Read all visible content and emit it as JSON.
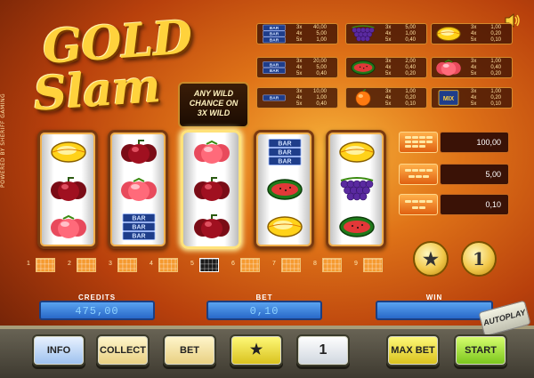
{
  "side_credit": "POWERED BY SHERIFF GAMING",
  "logo": {
    "line1": "GOLD",
    "line2": "Slam"
  },
  "any_wild": {
    "line1": "ANY WILD",
    "line2": "CHANCE ON",
    "line3": "3X WILD"
  },
  "paytable": [
    {
      "symbol": "triple-bar",
      "nums": [
        "3x",
        "40,00",
        "4x",
        "5,00",
        "5x",
        "1,00"
      ]
    },
    {
      "symbol": "grapes",
      "nums": [
        "3x",
        "5,00",
        "4x",
        "1,00",
        "5x",
        "0,40"
      ]
    },
    {
      "symbol": "lemon",
      "nums": [
        "3x",
        "1,00",
        "4x",
        "0,20",
        "5x",
        "0,10"
      ]
    },
    {
      "symbol": "double-bar",
      "nums": [
        "3x",
        "20,00",
        "4x",
        "5,00",
        "5x",
        "0,40"
      ]
    },
    {
      "symbol": "watermelon",
      "nums": [
        "3x",
        "2,00",
        "4x",
        "0,40",
        "5x",
        "0,20"
      ]
    },
    {
      "symbol": "tomato",
      "nums": [
        "3x",
        "1,00",
        "4x",
        "0,40",
        "5x",
        "0,20"
      ]
    },
    {
      "symbol": "single-bar",
      "nums": [
        "3x",
        "10,00",
        "4x",
        "1,00",
        "5x",
        "0,40"
      ]
    },
    {
      "symbol": "orange",
      "nums": [
        "3x",
        "1,00",
        "4x",
        "0,20",
        "5x",
        "0,10"
      ]
    },
    {
      "symbol": "mix-bar",
      "nums": [
        "3x",
        "1,00",
        "4x",
        "0,20",
        "5x",
        "0,10"
      ]
    }
  ],
  "mix_label": "MIX",
  "bar_label": "BAR",
  "reels": [
    [
      "lemon",
      "plum",
      "tomato"
    ],
    [
      "plum",
      "tomato",
      "triple-bar"
    ],
    [
      "tomato",
      "plum",
      "plum"
    ],
    [
      "triple-bar",
      "watermelon",
      "lemon"
    ],
    [
      "lemon",
      "grapes",
      "watermelon"
    ]
  ],
  "bet_levels": [
    {
      "value": "100,00"
    },
    {
      "value": "5,00"
    },
    {
      "value": "0,10"
    }
  ],
  "coin_star": "★",
  "coin_one": "1",
  "lines": [
    "1",
    "2",
    "3",
    "4",
    "5",
    "6",
    "7",
    "8",
    "9"
  ],
  "active_line": "5",
  "panels": {
    "credits_label": "CREDITS",
    "credits_value": "475,00",
    "bet_label": "BET",
    "bet_value": "0,10",
    "win_label": "WIN",
    "win_value": ""
  },
  "autoplay_label": "AUTOPLAY",
  "buttons": {
    "info": "INFO",
    "collect": "COLLECT",
    "bet": "BET",
    "star": "★",
    "one": "1",
    "max_bet": "MAX BET",
    "start": "START"
  },
  "colors": {
    "accent": "#f59a30",
    "panel_blue": "#3d80d8",
    "reel_border": "#7a3a10"
  }
}
